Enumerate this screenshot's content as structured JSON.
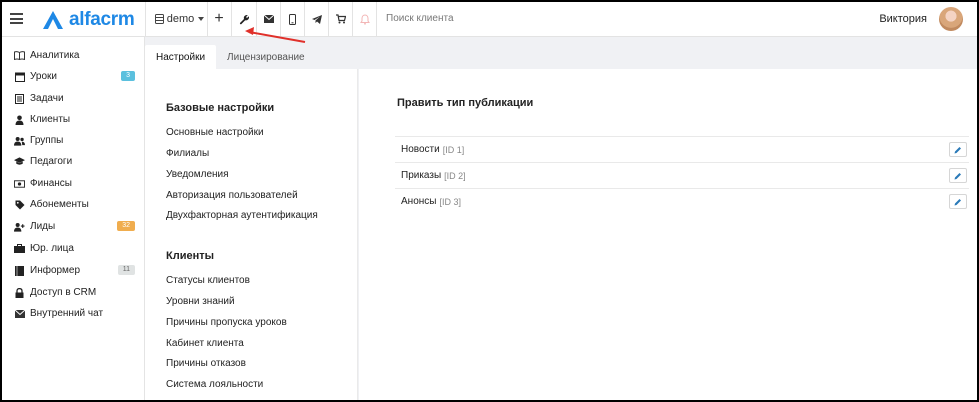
{
  "app": {
    "brand": "alfacrm",
    "brand_color": "#1e88e5"
  },
  "topbar": {
    "branch": "demo",
    "add_label": "+",
    "search_placeholder": "Поиск клиента",
    "user_name": "Виктория",
    "icons": [
      "menu-icon",
      "database-icon",
      "plus-icon",
      "wrench-icon",
      "envelope-icon",
      "mobile-icon",
      "telegram-icon",
      "cart-icon",
      "bell-icon"
    ]
  },
  "sidebar": {
    "items": [
      {
        "label": "Аналитика",
        "icon": "book-icon"
      },
      {
        "label": "Уроки",
        "icon": "calendar-icon",
        "badge": "3",
        "badge_color": "#5bc0de"
      },
      {
        "label": "Задачи",
        "icon": "tasks-icon"
      },
      {
        "label": "Клиенты",
        "icon": "user-icon"
      },
      {
        "label": "Группы",
        "icon": "users-icon"
      },
      {
        "label": "Педагоги",
        "icon": "graduation-cap-icon"
      },
      {
        "label": "Финансы",
        "icon": "money-icon"
      },
      {
        "label": "Абонементы",
        "icon": "tag-icon"
      },
      {
        "label": "Лиды",
        "icon": "user-plus-icon",
        "badge": "32",
        "badge_color": "#f0ad4e"
      },
      {
        "label": "Юр. лица",
        "icon": "briefcase-icon"
      },
      {
        "label": "Информер",
        "icon": "book-closed-icon",
        "badge": "11",
        "badge_color": "#e0e3e3"
      },
      {
        "label": "Доступ в CRM",
        "icon": "lock-icon"
      },
      {
        "label": "Внутренний чат",
        "icon": "envelope-icon"
      }
    ]
  },
  "tabs": [
    {
      "label": "Настройки"
    },
    {
      "label": "Лицензирование"
    }
  ],
  "settings": {
    "base_title": "Базовые настройки",
    "base_links": [
      "Основные настройки",
      "Филиалы",
      "Уведомления",
      "Авторизация пользователей",
      "Двухфакторная аутентификация"
    ],
    "clients_title": "Клиенты",
    "client_links": [
      "Статусы клиентов",
      "Уровни знаний",
      "Причины пропуска уроков",
      "Кабинет клиента",
      "Причины отказов",
      "Система лояльности"
    ]
  },
  "editor": {
    "title": "Править тип публикации",
    "rows": [
      {
        "name": "Новости",
        "id": "[ID 1]"
      },
      {
        "name": "Приказы",
        "id": "[ID 2]"
      },
      {
        "name": "Анонсы",
        "id": "[ID 3]"
      }
    ]
  }
}
